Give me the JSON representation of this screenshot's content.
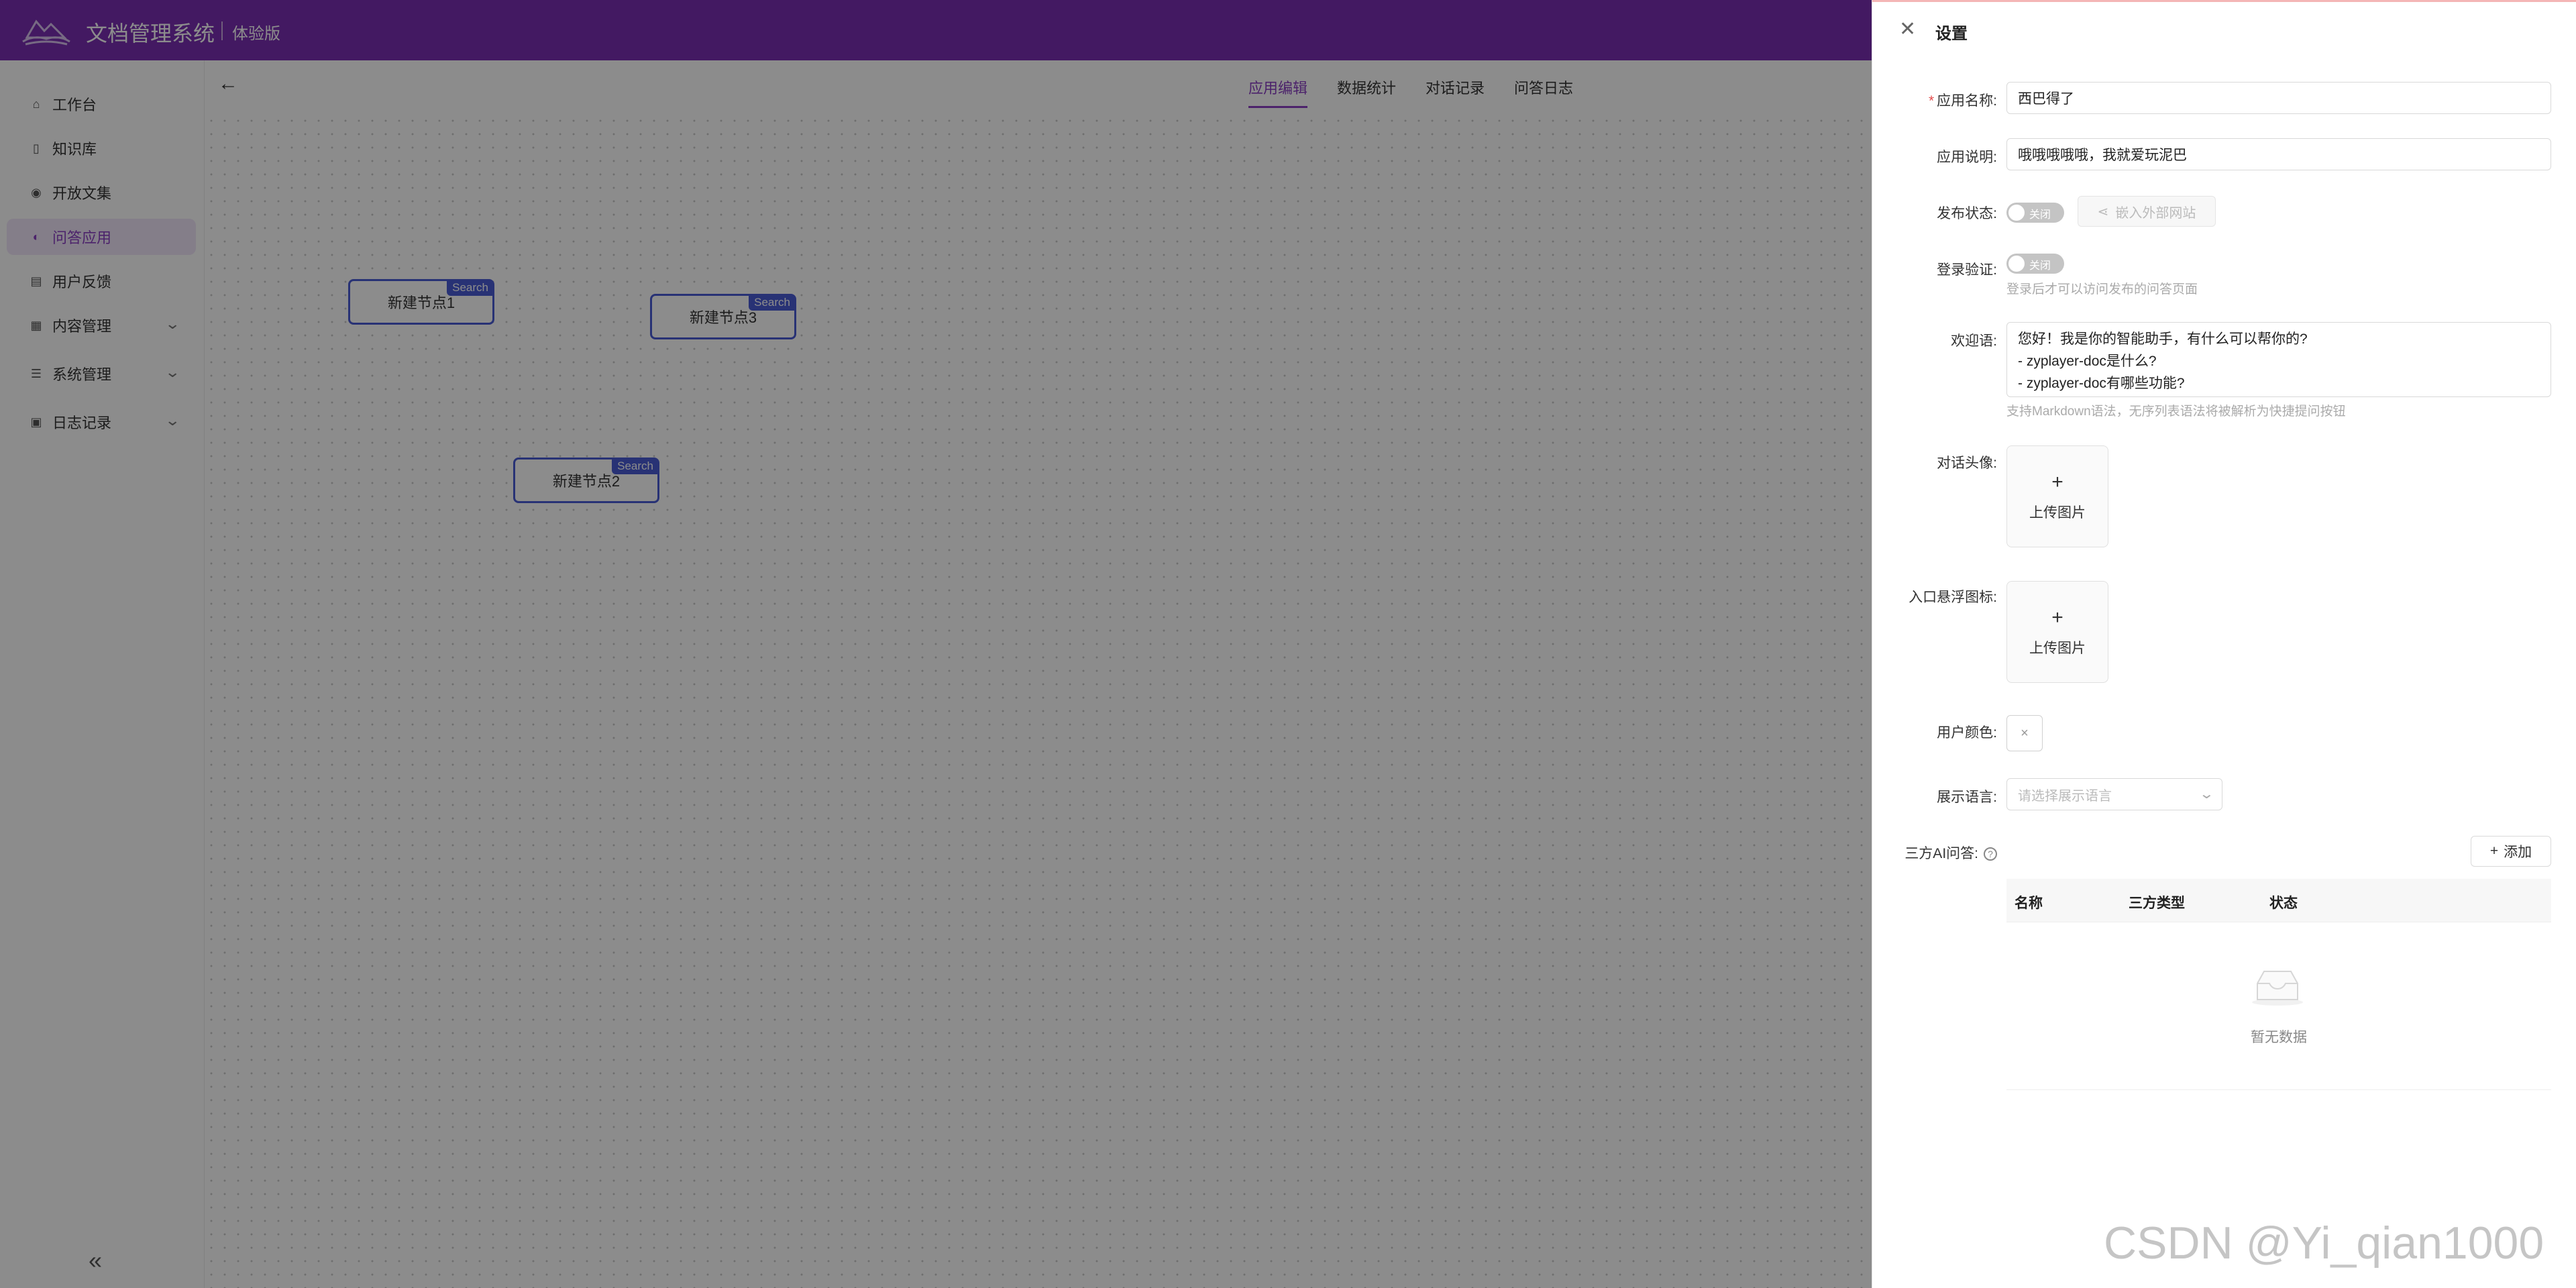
{
  "header": {
    "title": "文档管理系统",
    "edition": "体验版"
  },
  "sidebar": {
    "items": [
      {
        "label": "工作台",
        "icon": "home-icon",
        "active": false
      },
      {
        "label": "知识库",
        "icon": "book-icon",
        "active": false
      },
      {
        "label": "开放文集",
        "icon": "eye-icon",
        "active": false
      },
      {
        "label": "问答应用",
        "icon": "palette-icon",
        "active": true
      },
      {
        "label": "用户反馈",
        "icon": "feedback-icon",
        "active": false
      },
      {
        "label": "内容管理",
        "icon": "grid-icon",
        "active": false,
        "expandable": true
      },
      {
        "label": "系统管理",
        "icon": "sliders-icon",
        "active": false,
        "expandable": true
      },
      {
        "label": "日志记录",
        "icon": "log-icon",
        "active": false,
        "expandable": true
      }
    ],
    "collapse_glyph": "«"
  },
  "main": {
    "tabs": [
      {
        "label": "应用编辑",
        "active": true
      },
      {
        "label": "数据统计",
        "active": false
      },
      {
        "label": "对话记录",
        "active": false
      },
      {
        "label": "问答日志",
        "active": false
      }
    ],
    "nodes": [
      {
        "label": "新建节点1",
        "tag": "Search"
      },
      {
        "label": "新建节点3",
        "tag": "Search"
      },
      {
        "label": "新建节点2",
        "tag": "Search"
      }
    ]
  },
  "drawer": {
    "title": "设置",
    "app_name": {
      "label": "应用名称:",
      "value": "西巴得了"
    },
    "app_desc": {
      "label": "应用说明:",
      "value": "哦哦哦哦哦，我就爱玩泥巴"
    },
    "publish": {
      "label": "发布状态:",
      "switch_text": "关闭",
      "embed_label": "嵌入外部网站"
    },
    "login": {
      "label": "登录验证:",
      "switch_text": "关闭",
      "help": "登录后才可以访问发布的问答页面"
    },
    "welcome": {
      "label": "欢迎语:",
      "lines": [
        "您好！我是你的智能助手，有什么可以帮你的?",
        "- zyplayer-doc是什么?",
        "- zyplayer-doc有哪些功能?"
      ],
      "help": "支持Markdown语法，无序列表语法将被解析为快捷提问按钮"
    },
    "avatar": {
      "label": "对话头像:",
      "plus": "+",
      "upload_text": "上传图片"
    },
    "float_icon": {
      "label": "入口悬浮图标:",
      "plus": "+",
      "upload_text": "上传图片"
    },
    "user_color": {
      "label": "用户颜色:",
      "glyph": "×"
    },
    "language": {
      "label": "展示语言:",
      "placeholder": "请选择展示语言"
    },
    "third_party": {
      "label": "三方AI问答:",
      "help_glyph": "?",
      "add_label": "添加",
      "columns": [
        "名称",
        "三方类型",
        "状态"
      ],
      "empty_text": "暂无数据"
    }
  },
  "watermark": "CSDN @Yi_qian1000",
  "colors": {
    "brand": "#7a2fb3",
    "accent": "#8a3fc4",
    "node_border": "#4a5bd6"
  }
}
